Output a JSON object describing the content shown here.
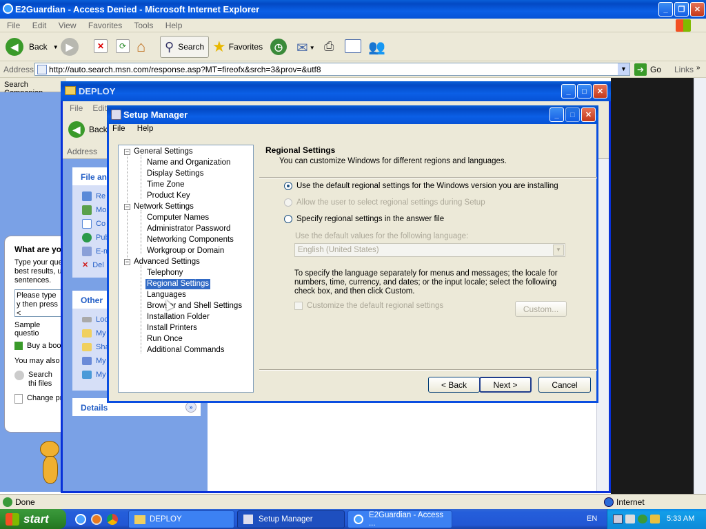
{
  "ie": {
    "title": "E2Guardian - Access Denied - Microsoft Internet Explorer",
    "menu": [
      "File",
      "Edit",
      "View",
      "Favorites",
      "Tools",
      "Help"
    ],
    "back": "Back",
    "search": "Search",
    "favorites": "Favorites",
    "address_label": "Address",
    "url": "http://auto.search.msn.com/response.asp?MT=fireofx&srch=3&prov=&utf8",
    "go": "Go",
    "links": "Links",
    "search_companion": "Search Companion",
    "status": "Done",
    "zone": "Internet"
  },
  "companion": {
    "question": "What are yo",
    "prompt": "Type your que best results, u sentences.",
    "input": "Please type y then press <",
    "sample": "Sample questio",
    "buy": "Buy a boo",
    "also": "You may also",
    "search_files": "Search thi files",
    "change": "Change pr"
  },
  "deploy": {
    "title": "DEPLOY",
    "menu": [
      "File",
      "Edit"
    ],
    "back": "Back",
    "address_label": "Address",
    "file_tasks": "File and",
    "items": [
      "Re",
      "Mo",
      "Co",
      "Pub",
      "E-m",
      "Del"
    ],
    "other": "Other",
    "other_items": [
      "Loc",
      "My",
      "Sha",
      "My",
      "My"
    ],
    "details": "Details"
  },
  "setup": {
    "title": "Setup Manager",
    "menu": [
      "File",
      "Help"
    ],
    "tree": [
      {
        "label": "General Settings",
        "level": 0
      },
      {
        "label": "Name and Organization",
        "level": 1
      },
      {
        "label": "Display Settings",
        "level": 1
      },
      {
        "label": "Time Zone",
        "level": 1
      },
      {
        "label": "Product Key",
        "level": 1
      },
      {
        "label": "Network Settings",
        "level": 0
      },
      {
        "label": "Computer Names",
        "level": 1
      },
      {
        "label": "Administrator Password",
        "level": 1
      },
      {
        "label": "Networking Components",
        "level": 1
      },
      {
        "label": "Workgroup or Domain",
        "level": 1
      },
      {
        "label": "Advanced Settings",
        "level": 0
      },
      {
        "label": "Telephony",
        "level": 1
      },
      {
        "label": "Regional Settings",
        "level": 1,
        "selected": true
      },
      {
        "label": "Languages",
        "level": 1
      },
      {
        "label": "Browser and Shell Settings",
        "level": 1
      },
      {
        "label": "Installation Folder",
        "level": 1
      },
      {
        "label": "Install Printers",
        "level": 1
      },
      {
        "label": "Run Once",
        "level": 1
      },
      {
        "label": "Additional Commands",
        "level": 1
      }
    ],
    "heading": "Regional Settings",
    "subheading": "You can customize Windows for different regions and languages.",
    "opt1": "Use the default regional settings for the Windows version you are installing",
    "opt2": "Allow the user to select regional settings during Setup",
    "opt3": "Specify regional settings in the answer file",
    "lang_label": "Use the default values for the following language:",
    "lang_value": "English (United States)",
    "info": "To specify the language separately for menus and messages; the locale for numbers, time, currency, and dates; or the input locale; select the following check box, and then click Custom.",
    "customize": "Customize the default regional settings",
    "custom_btn": "Custom...",
    "back_btn": "< Back",
    "next_btn": "Next >",
    "cancel_btn": "Cancel"
  },
  "taskbar": {
    "start": "start",
    "items": [
      "DEPLOY",
      "Setup Manager",
      "E2Guardian - Access ..."
    ],
    "lang": "EN",
    "time": "5:33 AM"
  }
}
